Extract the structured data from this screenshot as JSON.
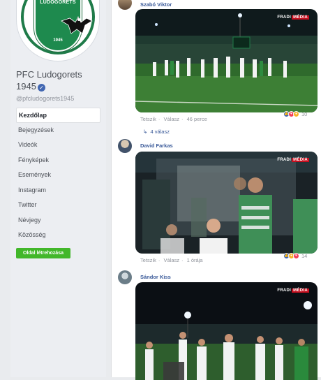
{
  "page": {
    "name": "PFC Ludogorets 1945",
    "handle": "@pfcludogorets1945",
    "logo": {
      "name": "LUDOGORETS",
      "year": "1945"
    }
  },
  "nav": {
    "items": [
      {
        "label": "Kezdőlap",
        "active": true
      },
      {
        "label": "Bejegyzések"
      },
      {
        "label": "Videók"
      },
      {
        "label": "Fényképek"
      },
      {
        "label": "Események"
      },
      {
        "label": "Instagram"
      },
      {
        "label": "Twitter"
      },
      {
        "label": "Névjegy"
      },
      {
        "label": "Közösség"
      }
    ],
    "create_page": "Oldal létrehozása"
  },
  "comments": [
    {
      "author": "Szabó Viktor",
      "watermark": "FRADI",
      "watermark_tag": "MÉDIA",
      "like": "Tetszik",
      "reply": "Válasz",
      "time": "46 perce",
      "reaction_count": "10",
      "replies_label": "4 válasz"
    },
    {
      "author": "David Farkas",
      "watermark": "FRADI",
      "watermark_tag": "MÉDIA",
      "like": "Tetszik",
      "reply": "Válasz",
      "time": "1 órája",
      "reaction_count": "14"
    },
    {
      "author": "Sándor Kiss",
      "watermark": "FRADI",
      "watermark_tag": "MÉDIA"
    }
  ],
  "colors": {
    "link": "#385898",
    "muted": "#90949c",
    "green": "#42b72a",
    "like": "#4267b2",
    "love": "#f33e58",
    "haha": "#f7b125"
  }
}
